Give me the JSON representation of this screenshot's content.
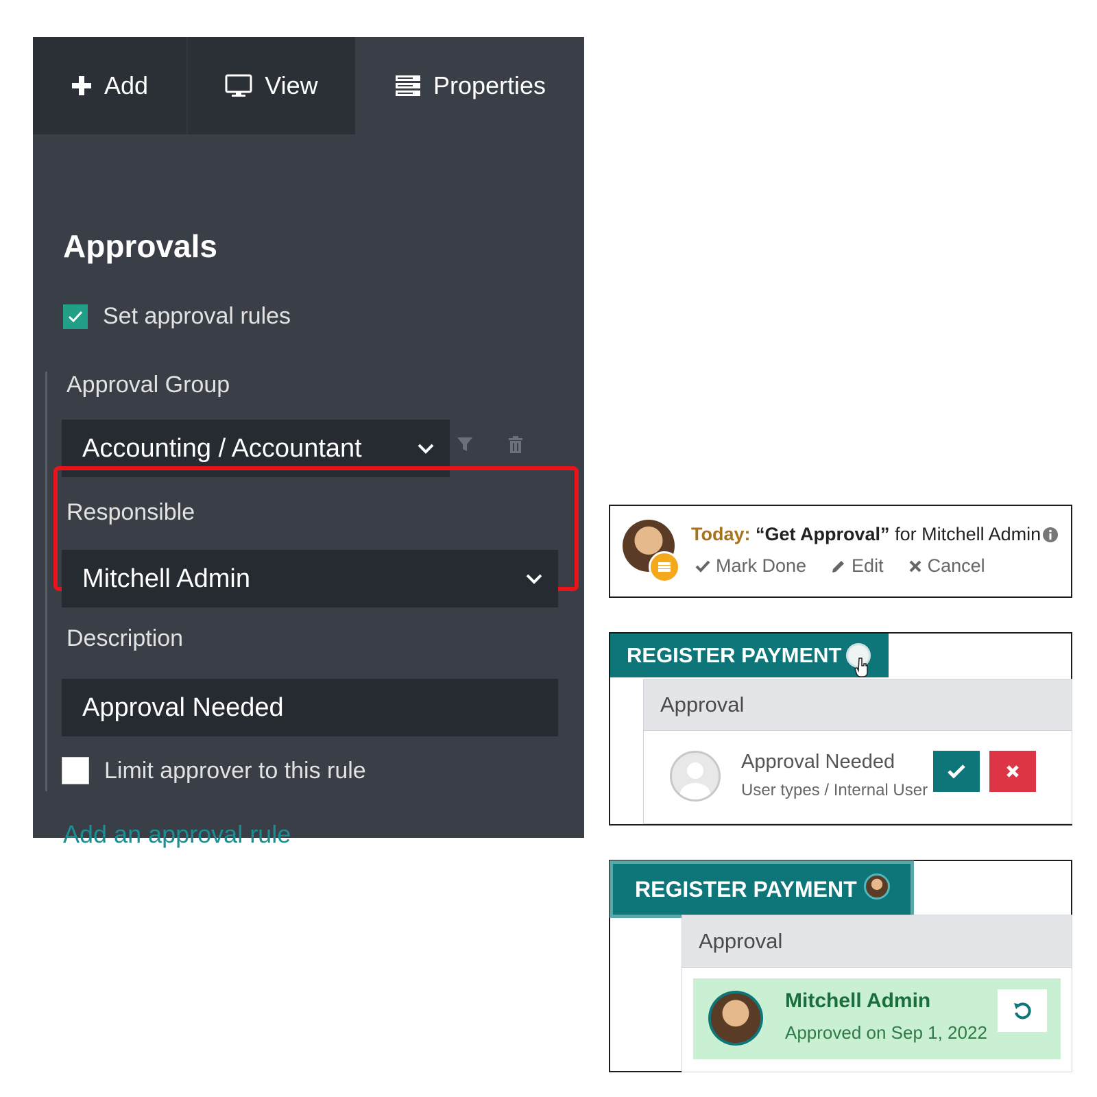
{
  "studio": {
    "tabs": {
      "add": "Add",
      "view": "View",
      "properties": "Properties"
    },
    "title": "Approvals",
    "set_rules_label": "Set approval rules",
    "set_rules_checked": true,
    "approval_group_label": "Approval Group",
    "approval_group_value": "Accounting / Accountant",
    "responsible_label": "Responsible",
    "responsible_value": "Mitchell Admin",
    "description_label": "Description",
    "description_value": "Approval Needed",
    "limit_label": "Limit approver to this rule",
    "limit_checked": false,
    "add_rule_link": "Add an approval rule"
  },
  "activity": {
    "today_label": "Today:",
    "summary": "“Get Approval”",
    "for_text": "for Mitchell Admin",
    "mark_done": "Mark Done",
    "edit": "Edit",
    "cancel": "Cancel"
  },
  "pending": {
    "button": "REGISTER PAYMENT",
    "header": "Approval",
    "title": "Approval Needed",
    "subtitle": "User types / Internal User"
  },
  "approved": {
    "button": "REGISTER PAYMENT",
    "header": "Approval",
    "name": "Mitchell Admin",
    "date": "Approved on Sep 1, 2022"
  },
  "colors": {
    "studio_bg": "#3a3e46",
    "tab_bg": "#2b2f36",
    "accent_teal": "#0e7578",
    "checkbox_green": "#21a087",
    "highlight_red": "#e8141a",
    "reject_red": "#dc3545",
    "approved_bg": "#c9f0d3",
    "today_gold": "#a7741e"
  }
}
